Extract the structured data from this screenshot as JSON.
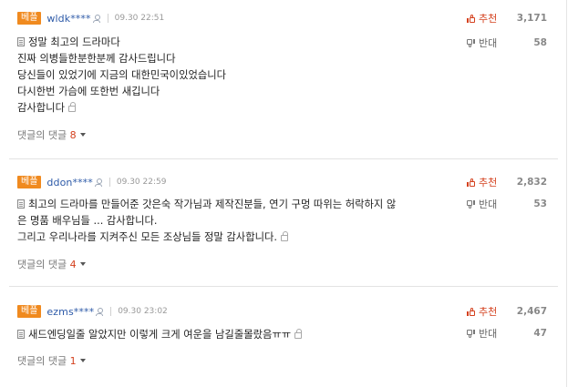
{
  "comments": [
    {
      "badge": "베플",
      "user": "wldk****",
      "time": "09.30 22:51",
      "lines": [
        "정말 최고의 드라마다",
        "진짜 의병들한분한분께 감사드립니다",
        "당신들이 있었기에 지금의 대한민국이있었습니다",
        "다시한번 가슴에 또한번 새깁니다",
        "감사합니다"
      ],
      "replies_label": "댓글의 댓글",
      "replies_count": "8",
      "up_label": "추천",
      "up_count": "3,171",
      "down_label": "반대",
      "down_count": "58"
    },
    {
      "badge": "베플",
      "user": "ddon****",
      "time": "09.30 22:59",
      "lines": [
        "최고의 드라마를 만들어준 갓은숙 작가님과 제작진분들, 연기 구멍 따위는 허락하지 않",
        "은 명품 배우님들 ... 감사합니다.",
        "그리고 우리나라를 지켜주신 모든 조상님들 정말 감사합니다."
      ],
      "replies_label": "댓글의 댓글",
      "replies_count": "4",
      "up_label": "추천",
      "up_count": "2,832",
      "down_label": "반대",
      "down_count": "53"
    },
    {
      "badge": "베플",
      "user": "ezms****",
      "time": "09.30 23:02",
      "lines": [
        "새드엔딩일줄 알았지만 이렇게 크게 여운을 남길줄몰랐음ㅠㅠ"
      ],
      "replies_label": "댓글의 댓글",
      "replies_count": "1",
      "up_label": "추천",
      "up_count": "2,467",
      "down_label": "반대",
      "down_count": "47"
    }
  ],
  "colors": {
    "badge": "#f08a1f",
    "user": "#2d5aa8",
    "up": "#d4401d",
    "reply_count": "#d4401d"
  },
  "icons": {
    "user": "user-icon",
    "doc": "document-icon",
    "lock": "lock-icon",
    "up": "thumbs-up-icon",
    "down": "thumbs-down-icon",
    "caret": "caret-down-icon"
  }
}
